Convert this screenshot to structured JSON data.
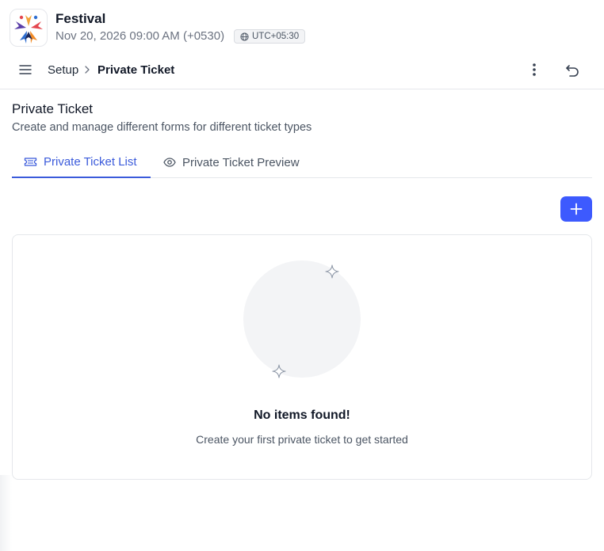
{
  "app": {
    "title": "Festival",
    "date": "Nov 20, 2026 09:00 AM (+0530)",
    "timezone": "UTC+05:30",
    "logo_icon": "festival-logo"
  },
  "nav": {
    "menu_icon": "hamburger-menu-icon",
    "breadcrumb": [
      "Setup",
      "Private Ticket"
    ],
    "more_icon": "more-vertical-icon",
    "undo_icon": "undo-icon"
  },
  "page": {
    "title": "Private Ticket",
    "subtitle": "Create and manage different forms for different ticket types"
  },
  "tabs": [
    {
      "label": "Private Ticket List",
      "icon": "ticket-icon",
      "active": true
    },
    {
      "label": "Private Ticket Preview",
      "icon": "eye-icon",
      "active": false
    }
  ],
  "add_button": {
    "icon": "plus-icon"
  },
  "empty_state": {
    "title": "No items found!",
    "description": "Create your first private ticket to get started"
  },
  "colors": {
    "accent": "#3b5bdb",
    "button": "#3d5afe",
    "border": "#e5e7eb",
    "muted_text": "#4b5563"
  }
}
